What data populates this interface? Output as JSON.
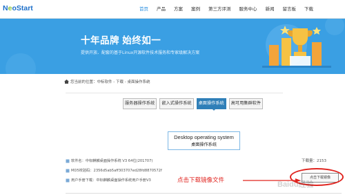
{
  "header": {
    "logo_prefix": "N",
    "logo_o": "e",
    "logo_suffix": "oStart",
    "nav": [
      {
        "label": "首页",
        "active": true
      },
      {
        "label": "产品",
        "active": false
      },
      {
        "label": "方案",
        "active": false
      },
      {
        "label": "案例",
        "active": false
      },
      {
        "label": "第三方评测",
        "active": false
      },
      {
        "label": "服务中心",
        "active": false
      },
      {
        "label": "新闻",
        "active": false
      },
      {
        "label": "留言板",
        "active": false
      },
      {
        "label": "下载",
        "active": false
      }
    ]
  },
  "banner": {
    "title": "十年品牌  始终如一",
    "subtitle": "提供开放、配套的基于Linux开源软件技术服务和专家级解决方案",
    "background": "#3a9fe3"
  },
  "breadcrumb": {
    "text": "您当前的位置：中标软件 - 下载 - 桌面操作系统",
    "icon": "home-icon"
  },
  "tabs": [
    {
      "label": "服务器操作系统",
      "active": false
    },
    {
      "label": "嵌入式操作系统",
      "active": false
    },
    {
      "label": "桌面操作系统",
      "active": true
    },
    {
      "label": "高可用集群软件",
      "active": false
    }
  ],
  "product": {
    "title_en": "Desktop operating system",
    "title_cn": "桌面操作系统"
  },
  "info": {
    "software_name": "软件名：中标麒麟桌面操作系统 V3 64位(201707)",
    "md5": "MD5校验码：2356d5ab5aff303707ed28fd8870572f",
    "manual": "用户手册下载：中标麒麟桌面操作系统用户手册V3",
    "downloads": "下载量：2153"
  },
  "download_button": {
    "label": "点击下载镜像"
  },
  "annotation": "点击下载镜像文件",
  "watermark": "Baidu经验",
  "colors": {
    "accent": "#2a8fe0",
    "active_tab": "#2f7fb8",
    "annotation": "#e0241f"
  }
}
